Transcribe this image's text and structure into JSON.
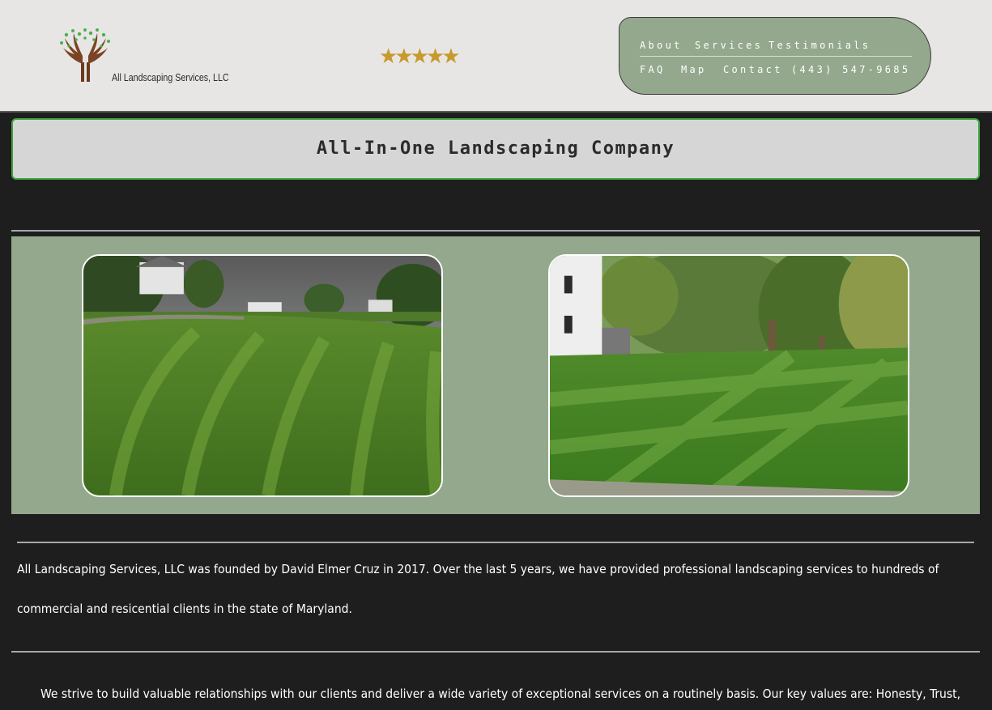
{
  "header": {
    "logo_text": "All Landscaping Services, LLC",
    "rating_stars": "★★★★★",
    "rating_value": 5
  },
  "nav": {
    "items": [
      "About",
      "Services",
      "Testimonials",
      "FAQ",
      "Map",
      "Contact"
    ],
    "phone": "(443) 547-9685"
  },
  "hero": {
    "title": "All-In-One Landscaping Company"
  },
  "about": {
    "paragraph1_line1": "All Landscaping Services, LLC was founded by David Elmer Cruz in 2017. Over the last 5 years, we have provided professional landscaping services to hundreds of",
    "paragraph1_line2": "commercial and resicential clients in the state of Maryland.",
    "paragraph2_line1": "We strive to build valuable relationships with our clients and deliver a wide variety of exceptional services on a routinely basis. Our key values are: Honesty, Trust,"
  },
  "colors": {
    "page_bg": "#1e1e1e",
    "header_bg": "#e8e6e5",
    "accent_green": "#93a88c",
    "title_border": "#3ea53e",
    "star_gold": "#c79a2b"
  }
}
